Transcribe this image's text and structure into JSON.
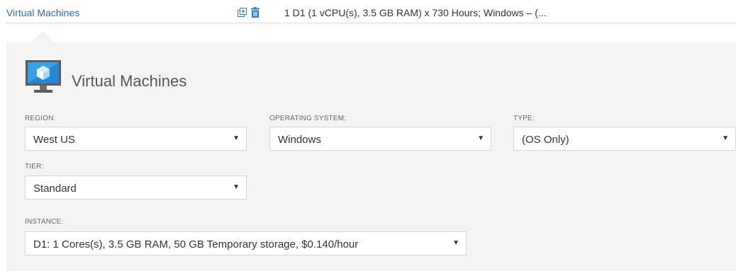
{
  "header": {
    "service_link": "Virtual Machines",
    "summary": "1 D1 (1 vCPU(s), 3.5 GB RAM) x 730 Hours; Windows – (..."
  },
  "icons": {
    "clone": "clone-icon",
    "delete": "trash-icon",
    "vm": "virtual-machine-monitor-icon"
  },
  "panel": {
    "title": "Virtual Machines",
    "fields": {
      "region": {
        "label": "REGION:",
        "value": "West US"
      },
      "os": {
        "label": "OPERATING SYSTEM:",
        "value": "Windows"
      },
      "type": {
        "label": "TYPE:",
        "value": "(OS Only)"
      },
      "tier": {
        "label": "TIER:",
        "value": "Standard"
      },
      "instance": {
        "label": "INSTANCE:",
        "value": "D1: 1 Cores(s), 3.5 GB RAM, 50 GB Temporary storage, $0.140/hour"
      }
    },
    "dropdown_arrow": "▼"
  },
  "colors": {
    "link": "#2b6cb5",
    "panel_bg": "#f4f4f4",
    "icon_blue": "#2b7cd3"
  }
}
